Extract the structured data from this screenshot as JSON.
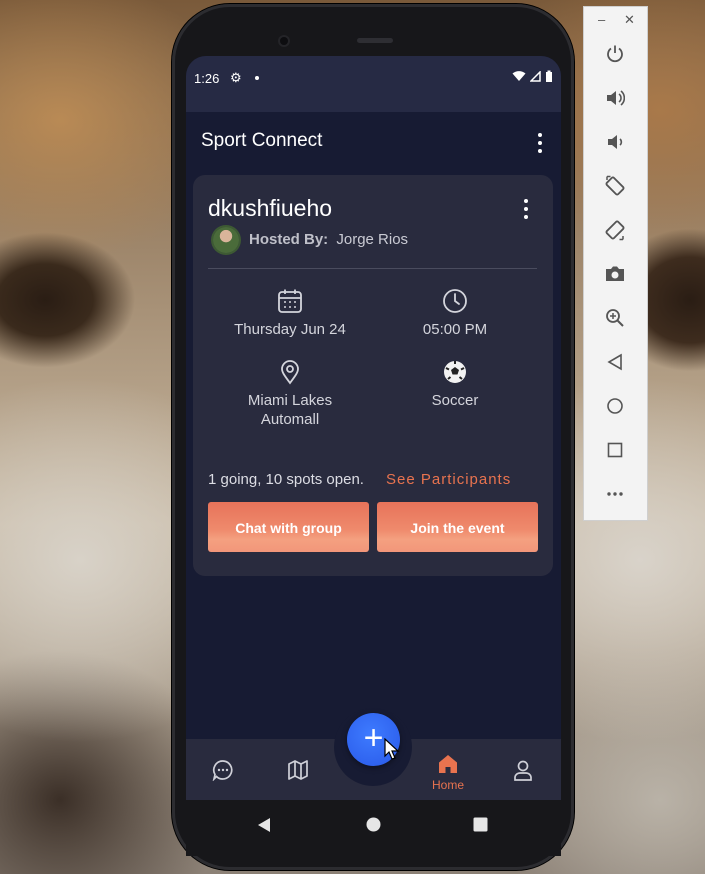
{
  "status_bar": {
    "time": "1:26"
  },
  "app": {
    "title": "Sport Connect"
  },
  "event": {
    "name": "dkushfiueho",
    "hosted_label": "Hosted By:",
    "host": "Jorge Rios",
    "date": "Thursday Jun 24",
    "time": "05:00 PM",
    "location_line1": "Miami Lakes",
    "location_line2": "Automall",
    "sport": "Soccer",
    "participation": "1 going, 10 spots open.",
    "see_participants": "See Participants",
    "chat_button": "Chat with group",
    "join_button": "Join the event"
  },
  "bottom_nav": {
    "items": [
      {
        "icon": "chat-icon",
        "label": ""
      },
      {
        "icon": "map-icon",
        "label": ""
      },
      {
        "icon": "home-icon",
        "label": "Home"
      },
      {
        "icon": "profile-icon",
        "label": ""
      }
    ],
    "fab_icon": "plus-icon"
  },
  "emulator_toolbar": {
    "buttons": [
      "power-icon",
      "volume-up-icon",
      "volume-down-icon",
      "rotate-left-icon",
      "rotate-right-icon",
      "camera-icon",
      "zoom-icon",
      "back-icon",
      "home-circle-icon",
      "overview-square-icon",
      "more-icon"
    ]
  },
  "colors": {
    "screen_bg": "#171b33",
    "card_bg": "#292b3e",
    "accent": "#e8734f",
    "fab": "#3069f5"
  }
}
